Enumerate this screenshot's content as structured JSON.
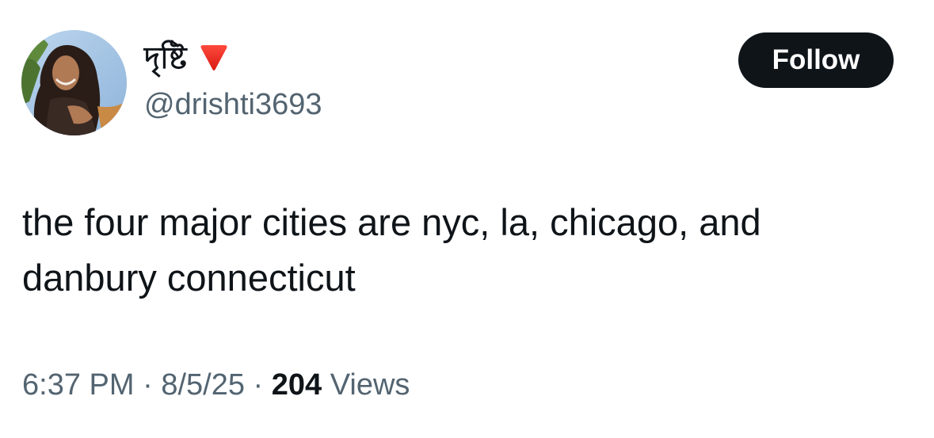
{
  "user": {
    "display_name": "দৃষ্টি",
    "name_emoji_icon": "red-down-triangle-icon",
    "handle": "@drishti3693",
    "avatar_icon": "profile-photo"
  },
  "follow_button": {
    "label": "Follow"
  },
  "tweet": {
    "text": "the four major cities are nyc, la, chicago, and\ndanbury connecticut"
  },
  "meta": {
    "time": "6:37 PM",
    "separator": "·",
    "date": "8/5/25",
    "views_count": "204",
    "views_label": "Views"
  },
  "colors": {
    "text_primary": "#0f1419",
    "text_secondary": "#536471",
    "button_bg": "#0f1419",
    "button_text": "#ffffff",
    "flag_red": "#e8251f"
  }
}
